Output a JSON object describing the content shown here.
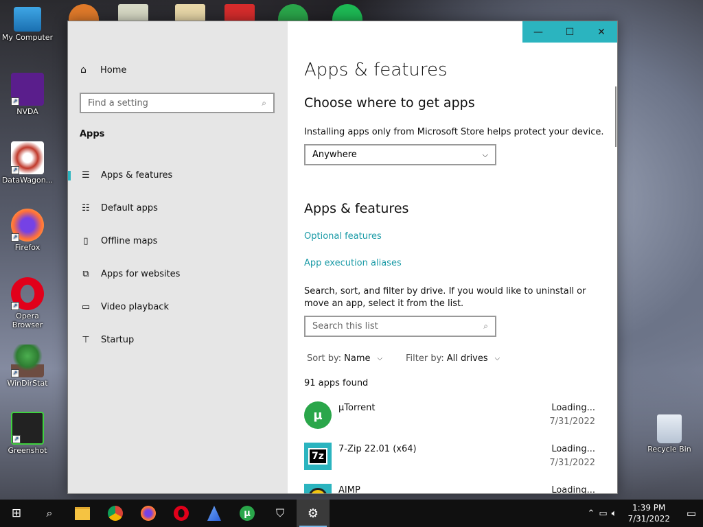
{
  "desktop": {
    "icons": [
      {
        "label": "My Computer"
      },
      {
        "label": "NVDA"
      },
      {
        "label": "DataWagon..."
      },
      {
        "label": "Firefox"
      },
      {
        "label": "Opera Browser"
      },
      {
        "label": "WinDirStat"
      },
      {
        "label": "Greenshot"
      },
      {
        "label": "Recycle Bin"
      }
    ]
  },
  "window": {
    "controls": {
      "minimize": "—",
      "maximize": "☐",
      "close": "✕"
    }
  },
  "sidebar": {
    "home": "Home",
    "search_placeholder": "Find a setting",
    "section": "Apps",
    "items": [
      {
        "label": "Apps & features",
        "icon": "list-icon"
      },
      {
        "label": "Default apps",
        "icon": "default-apps-icon"
      },
      {
        "label": "Offline maps",
        "icon": "map-icon"
      },
      {
        "label": "Apps for websites",
        "icon": "external-link-icon"
      },
      {
        "label": "Video playback",
        "icon": "video-icon"
      },
      {
        "label": "Startup",
        "icon": "startup-icon"
      }
    ]
  },
  "main": {
    "title": "Apps & features",
    "choose_heading": "Choose where to get apps",
    "choose_desc": "Installing apps only from Microsoft Store helps protect your device.",
    "source_value": "Anywhere",
    "apps_heading": "Apps & features",
    "link_optional": "Optional features",
    "link_aliases": "App execution aliases",
    "search_desc": "Search, sort, and filter by drive. If you would like to uninstall or move an app, select it from the list.",
    "search_placeholder": "Search this list",
    "sort_label": "Sort by:",
    "sort_value": "Name",
    "filter_label": "Filter by:",
    "filter_value": "All drives",
    "count": "91 apps found",
    "apps": [
      {
        "name": "µTorrent",
        "size": "Loading...",
        "date": "7/31/2022",
        "color": "#2aa64a"
      },
      {
        "name": "7-Zip 22.01 (x64)",
        "size": "Loading...",
        "date": "7/31/2022",
        "color": "#2bb4bf"
      },
      {
        "name": "AIMP",
        "size": "Loading...",
        "date": "",
        "color": "#2bb4bf"
      }
    ]
  },
  "taskbar": {
    "time": "1:39 PM",
    "date": "7/31/2022"
  }
}
